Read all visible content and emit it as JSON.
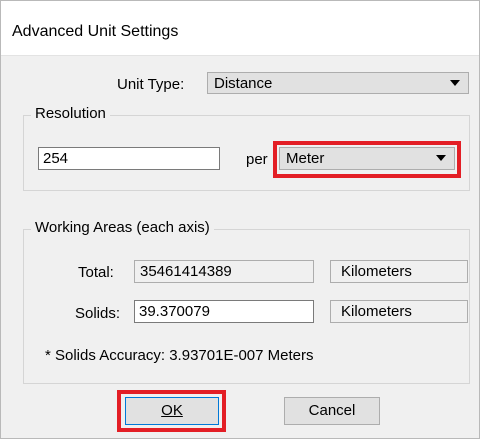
{
  "window": {
    "title": "Advanced Unit Settings"
  },
  "unit_type": {
    "label": "Unit Type:",
    "value": "Distance"
  },
  "resolution": {
    "group_title": "Resolution",
    "value": "254",
    "per_label": "per",
    "unit": "Meter"
  },
  "working_areas": {
    "group_title": "Working Areas (each axis)",
    "total_label": "Total:",
    "total_value": "35461414389",
    "total_unit": "Kilometers",
    "solids_label": "Solids:",
    "solids_value": "39.370079",
    "solids_unit": "Kilometers",
    "note": "* Solids Accuracy: 3.93701E-007 Meters"
  },
  "buttons": {
    "ok": "OK",
    "cancel": "Cancel"
  },
  "colors": {
    "highlight": "#e31e25",
    "focus": "#0078d7"
  }
}
